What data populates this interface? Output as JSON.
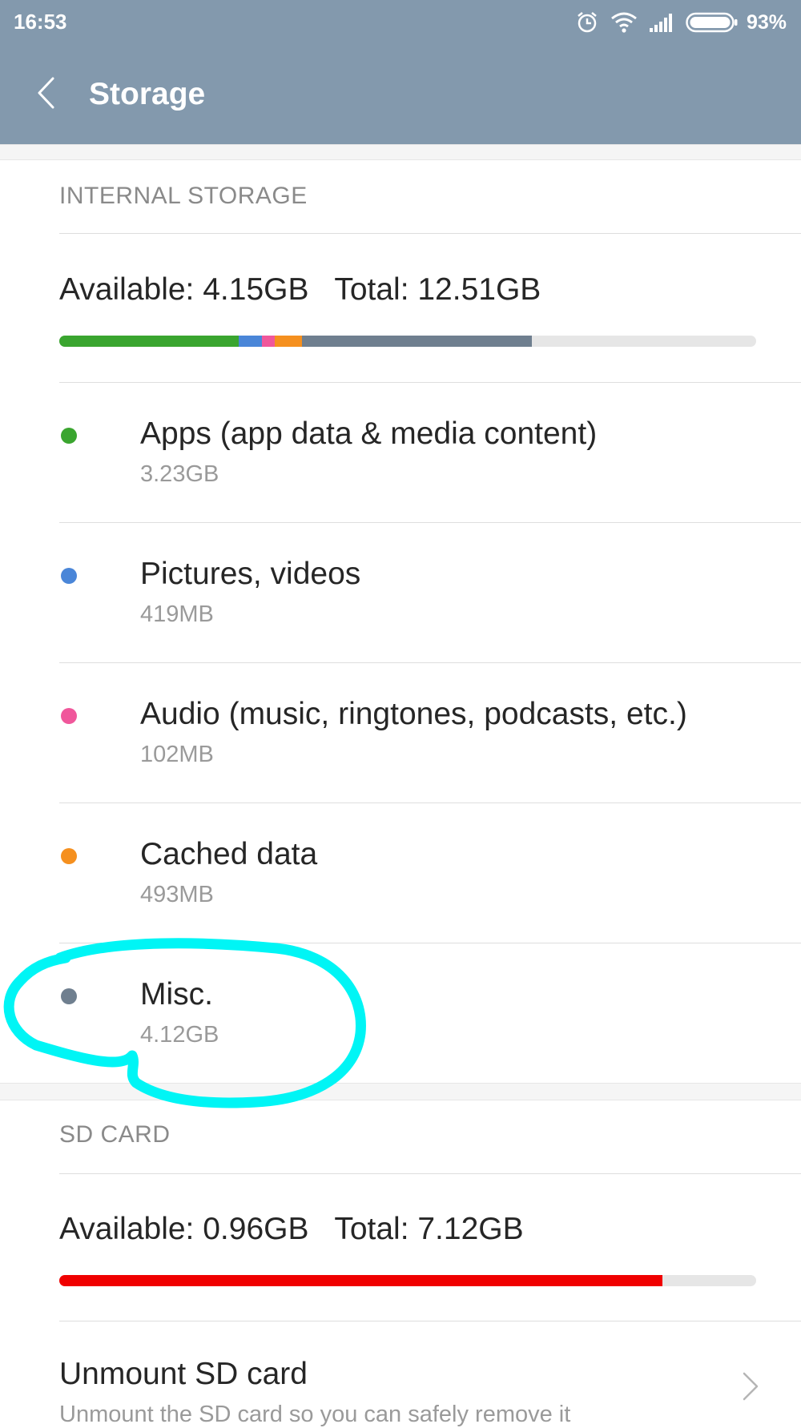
{
  "status_bar": {
    "time": "16:53",
    "battery_percent": "93%",
    "icons": [
      "alarm-icon",
      "wifi-icon",
      "signal-icon",
      "battery-icon"
    ]
  },
  "header": {
    "title": "Storage",
    "back_icon": "chevron-left-icon"
  },
  "internal": {
    "section_label": "INTERNAL STORAGE",
    "available": "Available: 4.15GB",
    "total": "Total: 12.51GB",
    "usage_bar": [
      {
        "name": "Apps",
        "fraction": 0.258,
        "color": "#3aa52f"
      },
      {
        "name": "Pictures, videos",
        "fraction": 0.033,
        "color": "#4a86d8"
      },
      {
        "name": "Audio",
        "fraction": 0.018,
        "color": "#f0579b"
      },
      {
        "name": "Cached data",
        "fraction": 0.039,
        "color": "#f5901f"
      },
      {
        "name": "Misc.",
        "fraction": 0.33,
        "color": "#6f7f8f"
      }
    ],
    "items": [
      {
        "label": "Apps (app data & media content)",
        "size": "3.23GB",
        "color": "#3aa52f"
      },
      {
        "label": "Pictures, videos",
        "size": "419MB",
        "color": "#4a86d8"
      },
      {
        "label": "Audio (music, ringtones, podcasts, etc.)",
        "size": "102MB",
        "color": "#f0579b"
      },
      {
        "label": "Cached data",
        "size": "493MB",
        "color": "#f5901f"
      },
      {
        "label": "Misc.",
        "size": "4.12GB",
        "color": "#6f7f8f"
      }
    ]
  },
  "sd_card": {
    "section_label": "SD CARD",
    "available": "Available: 0.96GB",
    "total": "Total: 7.12GB",
    "used_fraction": 0.865,
    "bar_color": "#f00000",
    "unmount_title": "Unmount SD card",
    "unmount_desc": "Unmount the SD card so you can safely remove it"
  },
  "annotation": {
    "highlight_color": "#00f5f5",
    "highlighted_item": "Misc."
  },
  "colors": {
    "app_bar": "#8399ad",
    "track": "#e6e6e6"
  }
}
